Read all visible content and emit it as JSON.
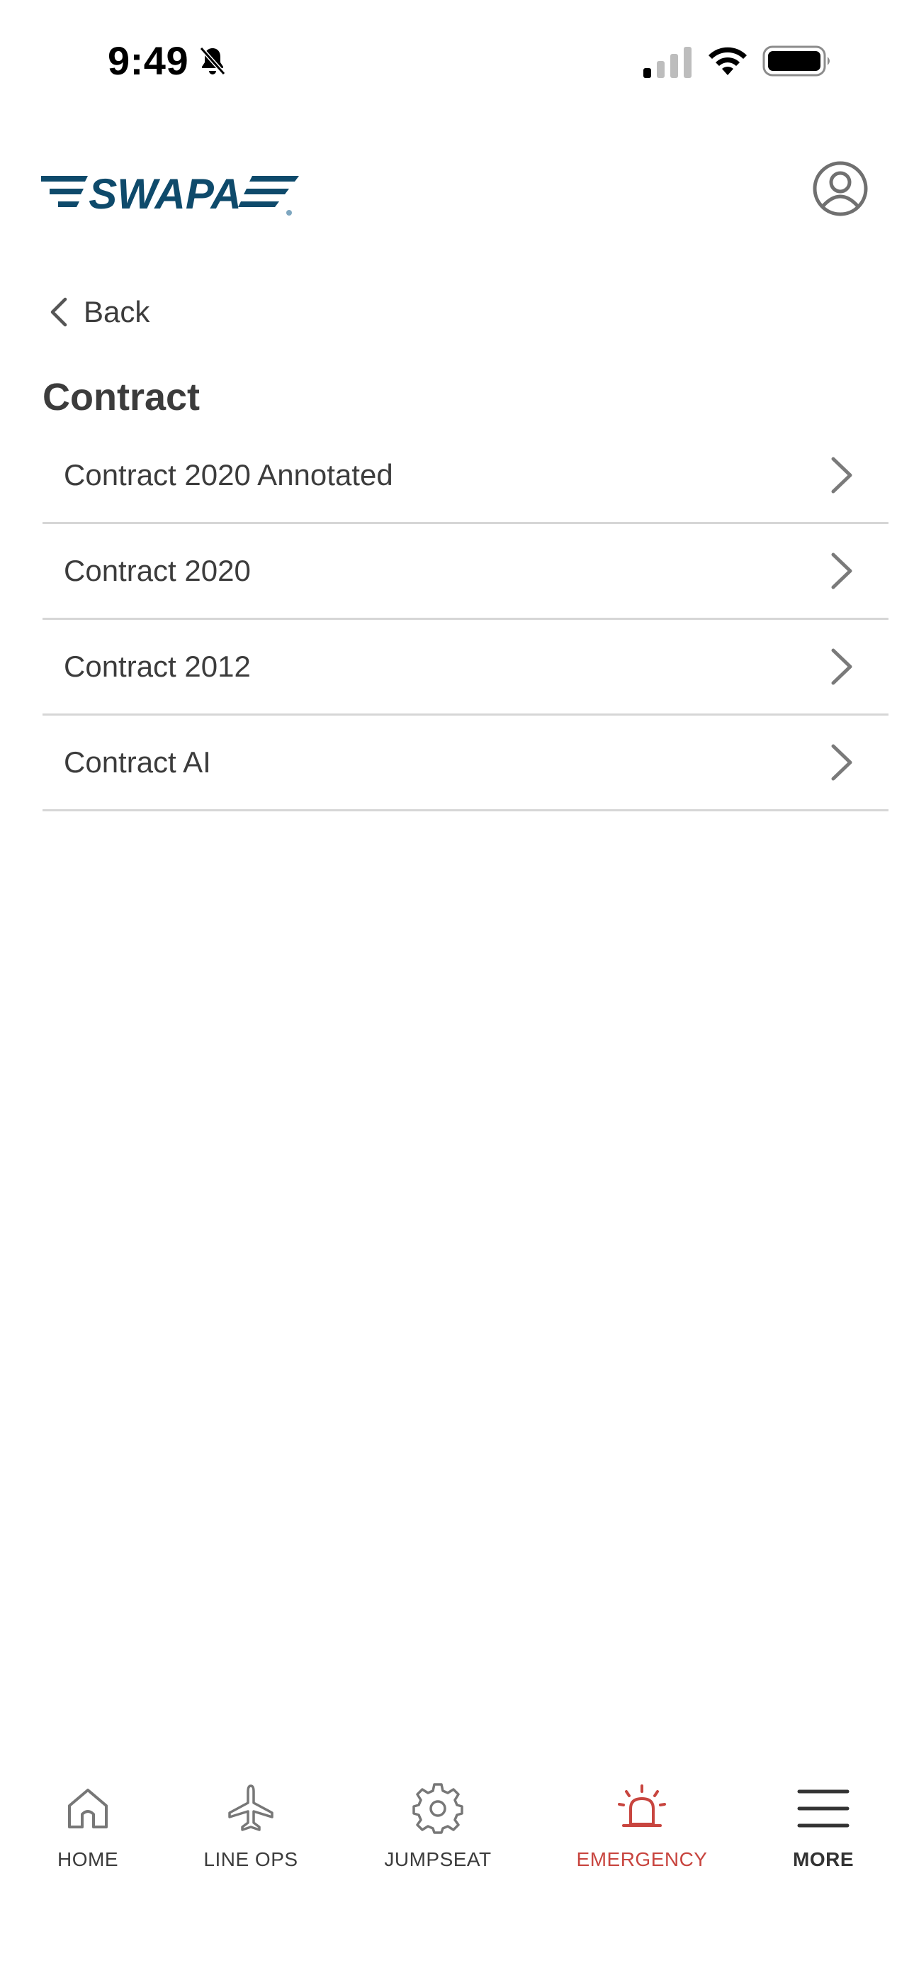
{
  "status_bar": {
    "time": "9:49",
    "icons": [
      "bell-slash-icon",
      "cellular-signal-icon",
      "wifi-icon",
      "battery-icon"
    ]
  },
  "header": {
    "logo_text": "SWAPA",
    "account_icon": "user-circle-icon"
  },
  "navigation": {
    "back_label": "Back"
  },
  "page": {
    "title": "Contract",
    "items": [
      {
        "label": "Contract 2020 Annotated"
      },
      {
        "label": "Contract 2020"
      },
      {
        "label": "Contract 2012"
      },
      {
        "label": "Contract AI"
      }
    ]
  },
  "tab_bar": {
    "tabs": [
      {
        "label": "HOME",
        "icon": "home-icon"
      },
      {
        "label": "LINE OPS",
        "icon": "airplane-icon"
      },
      {
        "label": "JUMPSEAT",
        "icon": "gear-icon"
      },
      {
        "label": "EMERGENCY",
        "icon": "alarm-siren-icon"
      },
      {
        "label": "MORE",
        "icon": "hamburger-menu-icon"
      }
    ]
  },
  "colors": {
    "brand": "#0e4a6b",
    "text": "#3c3c3c",
    "divider": "#d6d6d6",
    "emergency": "#c8453f",
    "chevron": "#7a7a7a"
  }
}
